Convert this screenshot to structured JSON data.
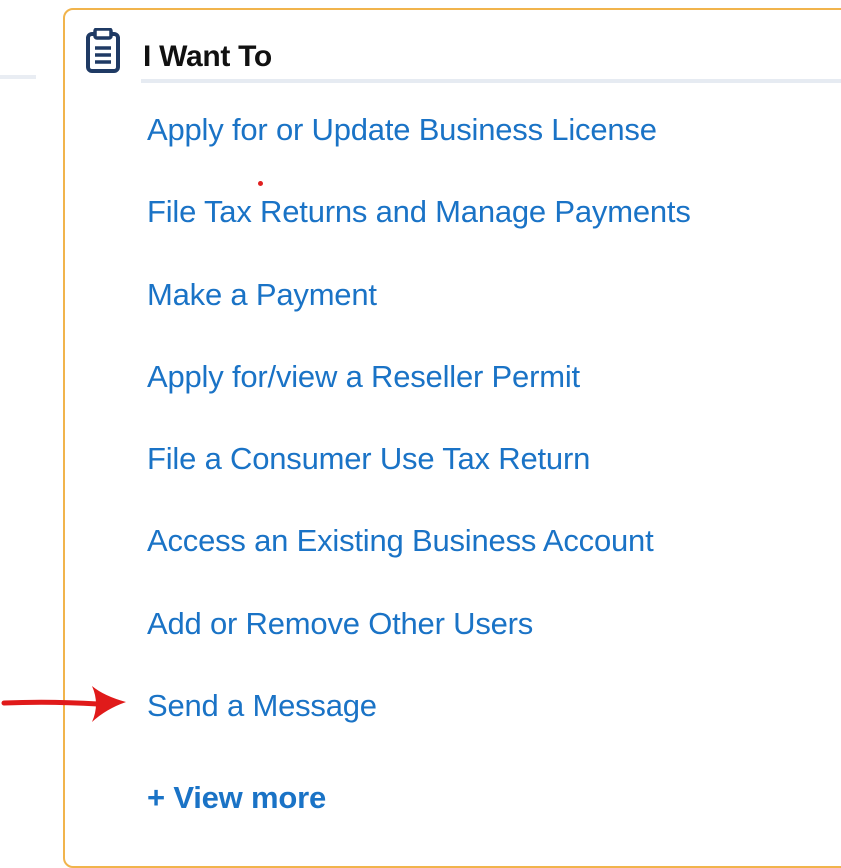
{
  "panel": {
    "title": "I Want To",
    "icon": "clipboard-icon",
    "border_color": "#f1b44c",
    "link_color": "#1a73c6",
    "links": [
      {
        "label": "Apply for or Update Business License"
      },
      {
        "label": "File Tax Returns and Manage Payments"
      },
      {
        "label": "Make a Payment"
      },
      {
        "label": "Apply for/view a Reseller Permit"
      },
      {
        "label": "File a Consumer Use Tax Return"
      },
      {
        "label": "Access an Existing Business Account"
      },
      {
        "label": "Add or Remove Other Users"
      },
      {
        "label": "Send a Message"
      }
    ],
    "view_more_label": "+ View more"
  },
  "annotation": {
    "arrow_icon": "red-arrow-icon",
    "arrow_color": "#e01a1a"
  }
}
